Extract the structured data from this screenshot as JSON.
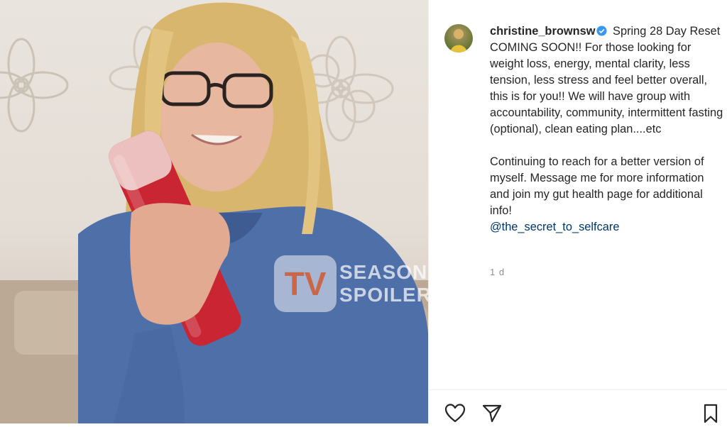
{
  "post": {
    "username": "christine_brownsw",
    "caption_p1": "Spring 28 Day Reset COMING SOON!! For those looking for weight loss, energy, mental clarity, less tension, less stress and feel better overall, this is for you!! We will have group with accountability, community, intermittent fasting (optional), clean eating plan....etc",
    "caption_p2": "Continuing to reach for a better version of myself. Message me for more information and join my gut health page for additional info!",
    "mention": "@the_secret_to_selfcare",
    "timestamp": "1 d"
  },
  "watermark": {
    "logo": "TV",
    "line1": "SEASON",
    "line2": "SPOILERS"
  },
  "icons": [
    "heart-icon",
    "share-icon",
    "bookmark-icon",
    "verified-icon"
  ],
  "colors": {
    "text": "#262626",
    "link": "#00376b",
    "verified": "#3897f0",
    "secondary": "#8e8e8e",
    "watermark": "#d9673f"
  }
}
